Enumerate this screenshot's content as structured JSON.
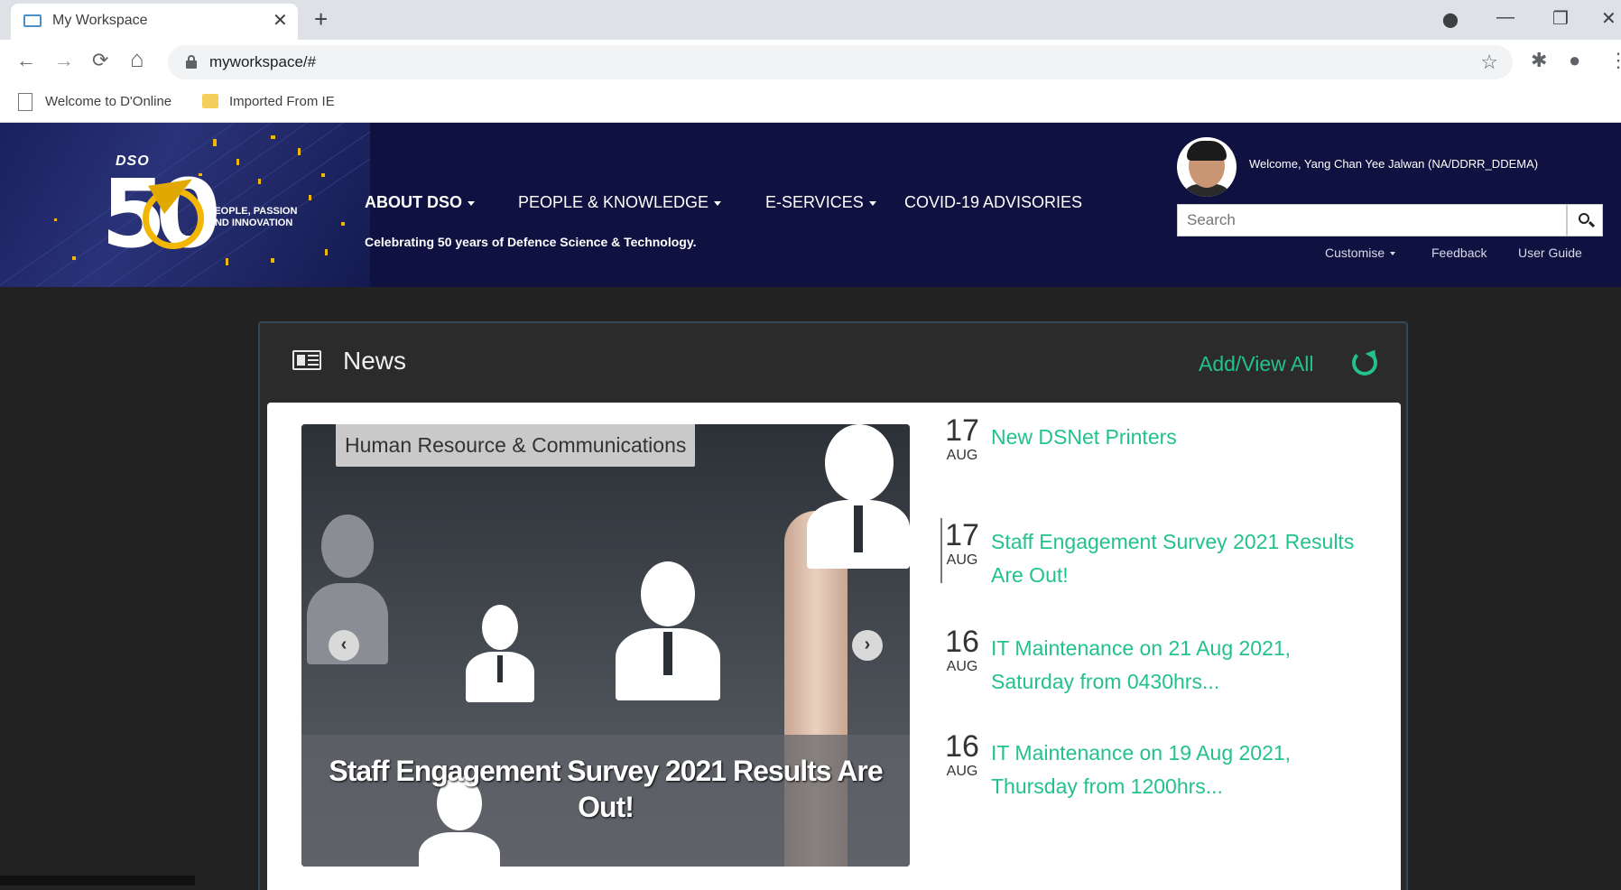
{
  "browser": {
    "tab_title": "My Workspace",
    "tab_close": "✕",
    "new_tab": "+",
    "url": "myworkspace/#",
    "back": "←",
    "forward": "→",
    "reload": "⟳",
    "home": "⌂",
    "star": "☆",
    "window_controls": {
      "profile_menu": "⬤",
      "minimize": "—",
      "restore": "❐",
      "close": "✕"
    },
    "extensions": "✱",
    "profile": "●",
    "menu": "⋮",
    "bookmarks": [
      {
        "label": "Welcome to D'Online",
        "icon": "page-icon"
      },
      {
        "label": "Imported From IE",
        "icon": "folder-icon"
      }
    ]
  },
  "header": {
    "logo": {
      "brand": "DSO",
      "number": "50",
      "tagline": "PEOPLE, PASSION AND INNOVATION"
    },
    "nav": [
      {
        "label": "ABOUT DSO"
      },
      {
        "label": "PEOPLE & KNOWLEDGE"
      },
      {
        "label": "E-SERVICES"
      },
      {
        "label": "COVID-19 ADVISORIES"
      }
    ],
    "tagline": "Celebrating 50 years of Defence Science & Technology.",
    "welcome": "Welcome, Yang Chan Yee Jalwan  (NA/DDRR_DDEMA)",
    "search_placeholder": "Search",
    "links": [
      "Customise",
      "Feedback",
      "User Guide"
    ]
  },
  "news": {
    "title": "News",
    "add_view_all": "Add/View All",
    "carousel": {
      "category": "Human Resource & Communications",
      "caption": "Staff Engagement Survey 2021 Results Are Out!",
      "prev": "‹",
      "next": "›"
    },
    "items": [
      {
        "day": "17",
        "month": "AUG",
        "title": "New DSNet Printers"
      },
      {
        "day": "17",
        "month": "AUG",
        "title": "Staff Engagement Survey 2021 Results Are Out!"
      },
      {
        "day": "16",
        "month": "AUG",
        "title": "IT Maintenance on 21 Aug 2021, Saturday from 0430hrs..."
      },
      {
        "day": "16",
        "month": "AUG",
        "title": "IT Maintenance on 19 Aug 2021, Thursday from 1200hrs..."
      }
    ]
  },
  "colors": {
    "accent": "#23c28a",
    "header_bg": "#0f1240",
    "page_bg": "#222222"
  }
}
